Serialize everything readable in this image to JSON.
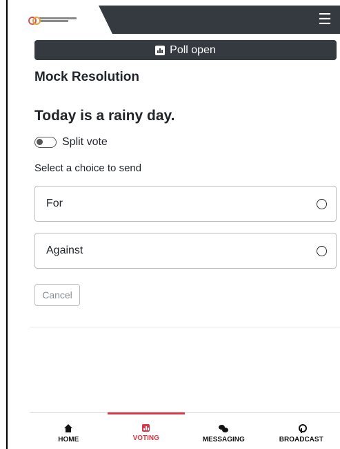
{
  "header": {
    "logo_name": "organisation-logo",
    "menu_icon": "hamburger-menu-icon",
    "menu_glyph": "☰"
  },
  "poll": {
    "status_label": "Poll open",
    "status_icon": "poll-chart-icon"
  },
  "resolution": {
    "title": "Mock Resolution",
    "question": "Today is a rainy day."
  },
  "split_vote": {
    "label": "Split vote",
    "enabled": false
  },
  "choices": {
    "prompt": "Select a choice to send",
    "items": [
      {
        "label": "For",
        "selected": false
      },
      {
        "label": "Against",
        "selected": false
      }
    ]
  },
  "actions": {
    "cancel_label": "Cancel"
  },
  "bottom_nav": {
    "active": "VOTING",
    "accent_color": "#dc3545",
    "items": [
      {
        "label": "HOME",
        "icon": "home-icon"
      },
      {
        "label": "VOTING",
        "icon": "voting-icon"
      },
      {
        "label": "MESSAGING",
        "icon": "messaging-icon"
      },
      {
        "label": "BROADCAST",
        "icon": "broadcast-icon"
      }
    ]
  },
  "colors": {
    "header_bg": "#343a40",
    "accent": "#dc3545"
  }
}
